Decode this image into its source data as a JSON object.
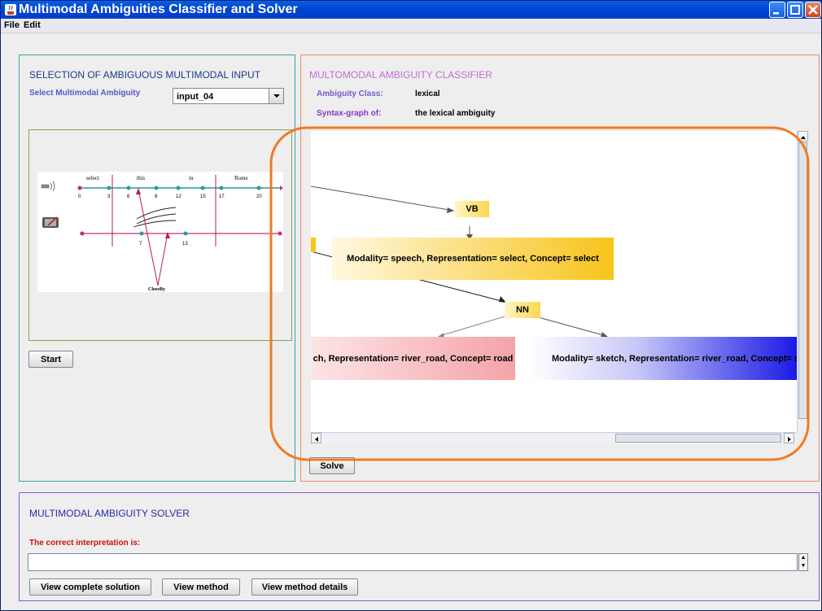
{
  "window": {
    "title": "Multimodal Ambiguities Classifier and Solver"
  },
  "menu": {
    "items": [
      "File",
      "Edit"
    ]
  },
  "selection_panel": {
    "title": "SELECTION OF AMBIGUOUS MULTIMODAL INPUT",
    "select_label": "Select Multimodal Ambiguity",
    "select_value": "input_04",
    "start_label": "Start",
    "timeline": {
      "speech_words": [
        "select",
        "this",
        "in",
        "Rome"
      ],
      "speech_ticks": [
        "0",
        "3",
        "6",
        "8",
        "12",
        "15",
        "17",
        "20"
      ],
      "sketch_ticks": [
        "7",
        "13"
      ],
      "sketch_label": "CloseBy"
    }
  },
  "classifier_panel": {
    "title": "MULTOMODAL AMBIGUITY CLASSIFIER",
    "class_label": "Ambiguity Class:",
    "class_value": "lexical",
    "graph_label": "Syntax-graph of:",
    "graph_value": "the lexical ambiguity",
    "solve_label": "Solve",
    "graph": {
      "vb": "VB",
      "nn": "NN",
      "speech_node": "Modality= speech, Representation= select, Concept= select",
      "road_node": "ch, Representation= river_road, Concept= road",
      "sketch_node": "Modality= sketch, Representation= river_road, Concept= river"
    }
  },
  "solver_panel": {
    "title": "MULTIMODAL AMBIGUITY SOLVER",
    "interp_label": "The correct interpretation is:",
    "interp_value": "",
    "buttons": [
      "View complete solution",
      "View method",
      "View method details"
    ]
  },
  "colors": {
    "highlight_ring": "#f07a24",
    "vb_nn_node": "#ffd54a",
    "speech_node": "#f7c41b",
    "road_node": "#f4a3a8",
    "sketch_node": "#1a1ae6",
    "panel_selection_border": "#3aa6a0",
    "panel_classifier_border": "#ee8866",
    "panel_solver_border": "#8a55d6",
    "timeline_speech": "#2a9a9a",
    "timeline_sketch": "#c2307a"
  },
  "icons": {
    "window": "java-cup-icon",
    "minimize": "minimize-icon",
    "maximize": "maximize-icon",
    "close": "close-icon",
    "speech": "microphone-icon",
    "sketch": "tablet-pen-icon",
    "combo": "chevron-down-icon"
  }
}
